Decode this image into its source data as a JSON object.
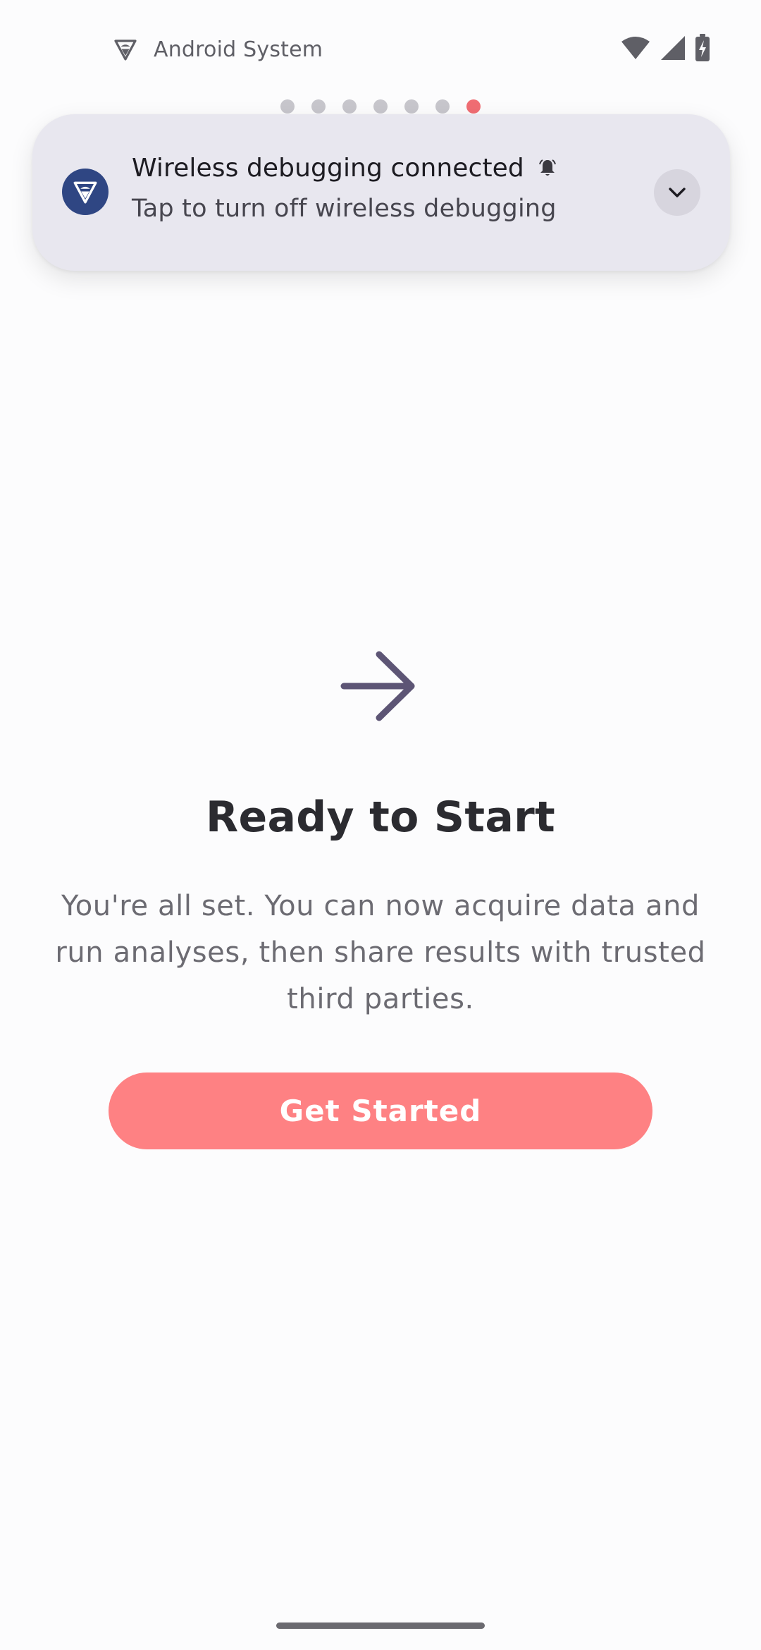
{
  "status_bar": {
    "app_name": "Android System",
    "app_icon": "android-debug-icon",
    "icons": [
      "wifi-icon",
      "cell-signal-icon",
      "battery-charging-icon"
    ]
  },
  "pager": {
    "total": 7,
    "active_index": 6,
    "active_color": "#f06d73",
    "inactive_color": "#c7c6cc"
  },
  "notification": {
    "title": "Wireless debugging connected",
    "text": "Tap to turn off wireless debugging",
    "icon": "android-debug-icon",
    "bell_icon": "bell-alert-icon",
    "expand_icon": "chevron-down-icon",
    "icon_bg_color": "#2f4683"
  },
  "main": {
    "icon": "arrow-right-icon",
    "title": "Ready to Start",
    "description": "You're all set. You can now acquire data and run analyses, then share results with trusted third parties.",
    "button_label": "Get Started",
    "button_color": "#fe8183"
  }
}
